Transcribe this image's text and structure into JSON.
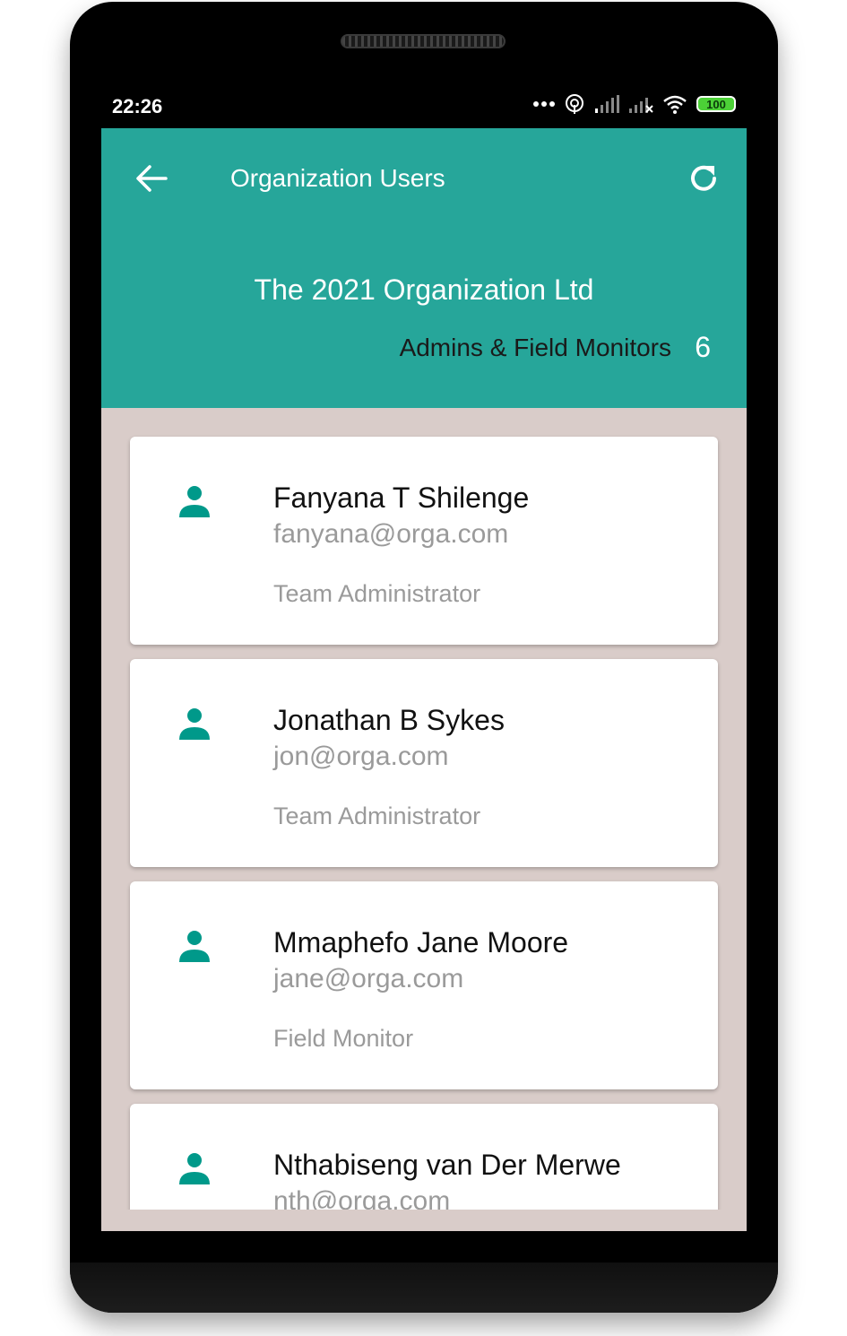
{
  "status_bar": {
    "time": "22:26",
    "battery": "100"
  },
  "app_bar": {
    "title": "Organization Users",
    "org_name": "The 2021 Organization Ltd",
    "subtitle": "Admins & Field Monitors",
    "count": "6",
    "accent_color": "#26a69a"
  },
  "users": [
    {
      "name": "Fanyana T Shilenge",
      "email": "fanyana@orga.com",
      "role": "Team Administrator"
    },
    {
      "name": "Jonathan B Sykes",
      "email": "jon@orga.com",
      "role": "Team Administrator"
    },
    {
      "name": "Mmaphefo Jane Moore",
      "email": "jane@orga.com",
      "role": "Field Monitor"
    },
    {
      "name": "Nthabiseng van Der Merwe",
      "email": "nth@orga.com",
      "role": ""
    }
  ],
  "icons": {
    "back": "arrow-left-icon",
    "refresh": "refresh-icon",
    "user": "person-icon"
  }
}
